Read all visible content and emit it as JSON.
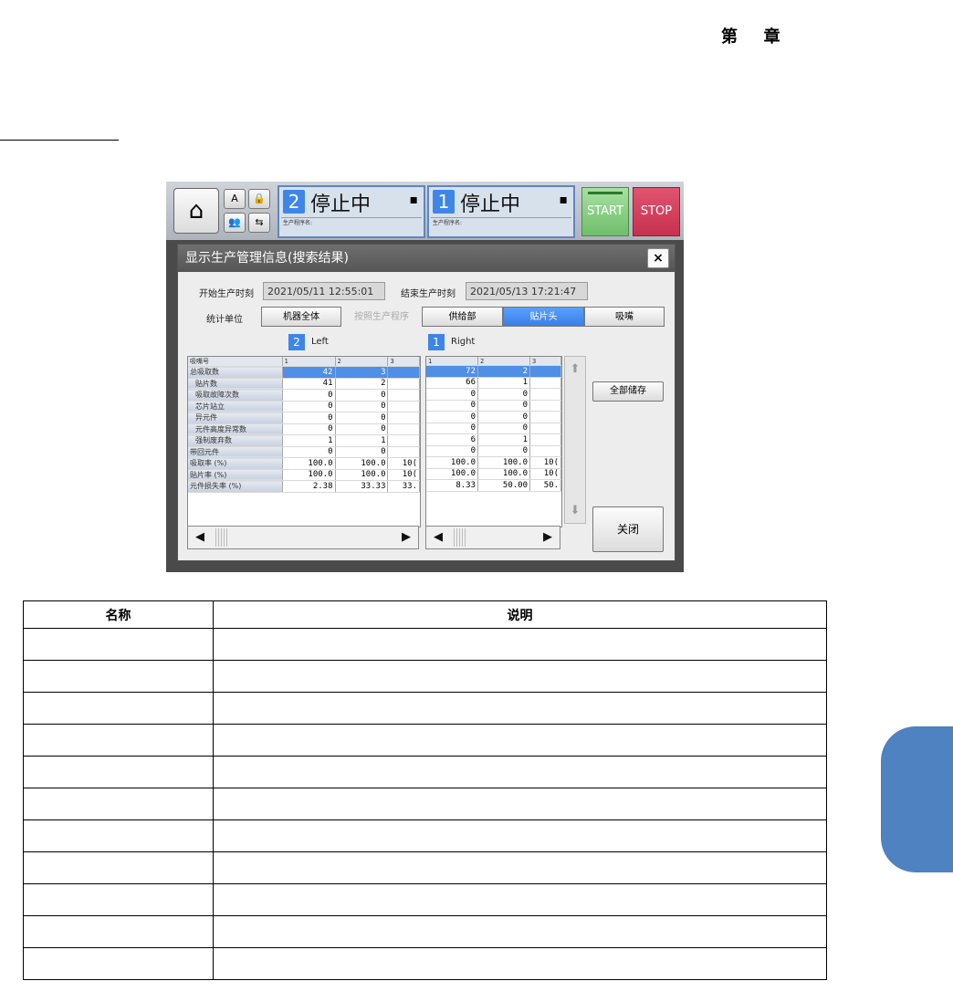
{
  "header": {
    "chapter_char1": "第",
    "chapter_char2": "章"
  },
  "screen": {
    "lanes": [
      {
        "num": "2",
        "status": "停止中",
        "prog_label": "生产程序名:"
      },
      {
        "num": "1",
        "status": "停止中",
        "prog_label": "生产程序名:"
      }
    ],
    "start_label": "START",
    "stop_label": "STOP",
    "dialog": {
      "title": "显示生产管理信息(搜索结果)",
      "close_label": "×",
      "start_time_label": "开始生产时刻",
      "start_time_value": "2021/05/11 12:55:01",
      "end_time_label": "结束生产时刻",
      "end_time_value": "2021/05/13 17:21:47",
      "unit_label": "统计单位",
      "segments": [
        "机器全体",
        "按照生产程序",
        "供给部",
        "贴片头",
        "吸嘴"
      ],
      "active_segment": "贴片头",
      "left": {
        "num": "2",
        "name": "Left"
      },
      "right": {
        "num": "1",
        "name": "Right"
      },
      "row_labels": [
        "吸嘴号",
        "总吸取数",
        "贴片数",
        "吸取故障次数",
        "芯片站立",
        "异元件",
        "元件高度异常数",
        "强制废弃数",
        "带回元件",
        "吸取率 (%)",
        "贴片率 (%)",
        "元件损失率 (%)"
      ],
      "left_cols": [
        "1",
        "2",
        "3"
      ],
      "left_values": [
        [
          "42",
          "3",
          ""
        ],
        [
          "41",
          "2",
          ""
        ],
        [
          "0",
          "0",
          ""
        ],
        [
          "0",
          "0",
          ""
        ],
        [
          "0",
          "0",
          ""
        ],
        [
          "0",
          "0",
          ""
        ],
        [
          "1",
          "1",
          ""
        ],
        [
          "0",
          "0",
          ""
        ],
        [
          "100.0",
          "100.0",
          "10("
        ],
        [
          "100.0",
          "100.0",
          "10("
        ],
        [
          "2.38",
          "33.33",
          "33."
        ]
      ],
      "right_cols": [
        "1",
        "2",
        "3"
      ],
      "right_values": [
        [
          "72",
          "2",
          ""
        ],
        [
          "66",
          "1",
          ""
        ],
        [
          "0",
          "0",
          ""
        ],
        [
          "0",
          "0",
          ""
        ],
        [
          "0",
          "0",
          ""
        ],
        [
          "0",
          "0",
          ""
        ],
        [
          "6",
          "1",
          ""
        ],
        [
          "0",
          "0",
          ""
        ],
        [
          "100.0",
          "100.0",
          "10("
        ],
        [
          "100.0",
          "100.0",
          "10("
        ],
        [
          "8.33",
          "50.00",
          "50."
        ]
      ],
      "save_all_label": "全部储存",
      "close_button_label": "关闭"
    }
  },
  "doc_table": {
    "headers": [
      "名称",
      "说明"
    ],
    "row_count": 11
  },
  "colors": {
    "accent_blue": "#3d86e8",
    "side_tab": "#4f82c0",
    "start_green": "#6fbf6b",
    "stop_red": "#c8304f"
  }
}
